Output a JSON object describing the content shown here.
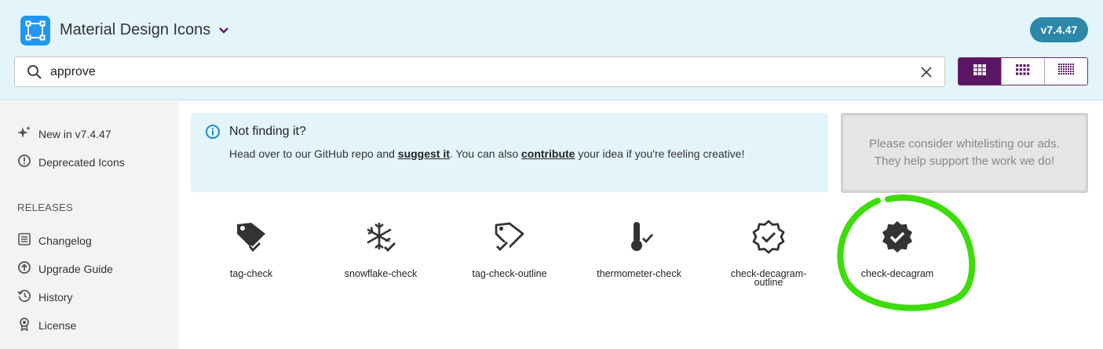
{
  "header": {
    "app_title": "Material Design Icons",
    "version": "v7.4.47",
    "logo_icon": "mdi-logo-icon",
    "chevron_icon": "chevron-down-icon"
  },
  "search": {
    "value": "approve",
    "placeholder": "",
    "search_icon": "search-icon",
    "clear_icon": "close-icon"
  },
  "view_toggle": {
    "options": [
      "large-grid-icon",
      "medium-grid-icon",
      "small-grid-icon"
    ],
    "active_index": 0
  },
  "sidebar": {
    "items": [
      {
        "label": "New in v7.4.47",
        "icon": "sparkles-icon"
      },
      {
        "label": "Deprecated Icons",
        "icon": "alert-circle-icon"
      }
    ],
    "releases_heading": "RELEASES",
    "release_items": [
      {
        "label": "Changelog",
        "icon": "list-box-icon"
      },
      {
        "label": "Upgrade Guide",
        "icon": "arrow-up-circle-icon"
      },
      {
        "label": "History",
        "icon": "history-icon"
      },
      {
        "label": "License",
        "icon": "certificate-icon"
      }
    ]
  },
  "info_box": {
    "title": "Not finding it?",
    "text_before": "Head over to our GitHub repo and ",
    "link1": "suggest it",
    "text_middle": ". You can also ",
    "link2": "contribute",
    "text_after": " your idea if you're feeling creative!"
  },
  "ad": {
    "line1": "Please consider whitelisting our ads.",
    "line2": "They help support the work we do!"
  },
  "results": [
    {
      "name": "tag-check"
    },
    {
      "name": "snowflake-check"
    },
    {
      "name": "tag-check-outline"
    },
    {
      "name": "thermometer-check"
    },
    {
      "name": "check-decagram-outline"
    },
    {
      "name": "check-decagram"
    }
  ],
  "colors": {
    "header_bg": "#e3f4fb",
    "accent_purple": "#5b1564",
    "version_badge": "#2b88a8",
    "logo_blue": "#2196f3",
    "highlight_green": "#3ddc0b"
  }
}
